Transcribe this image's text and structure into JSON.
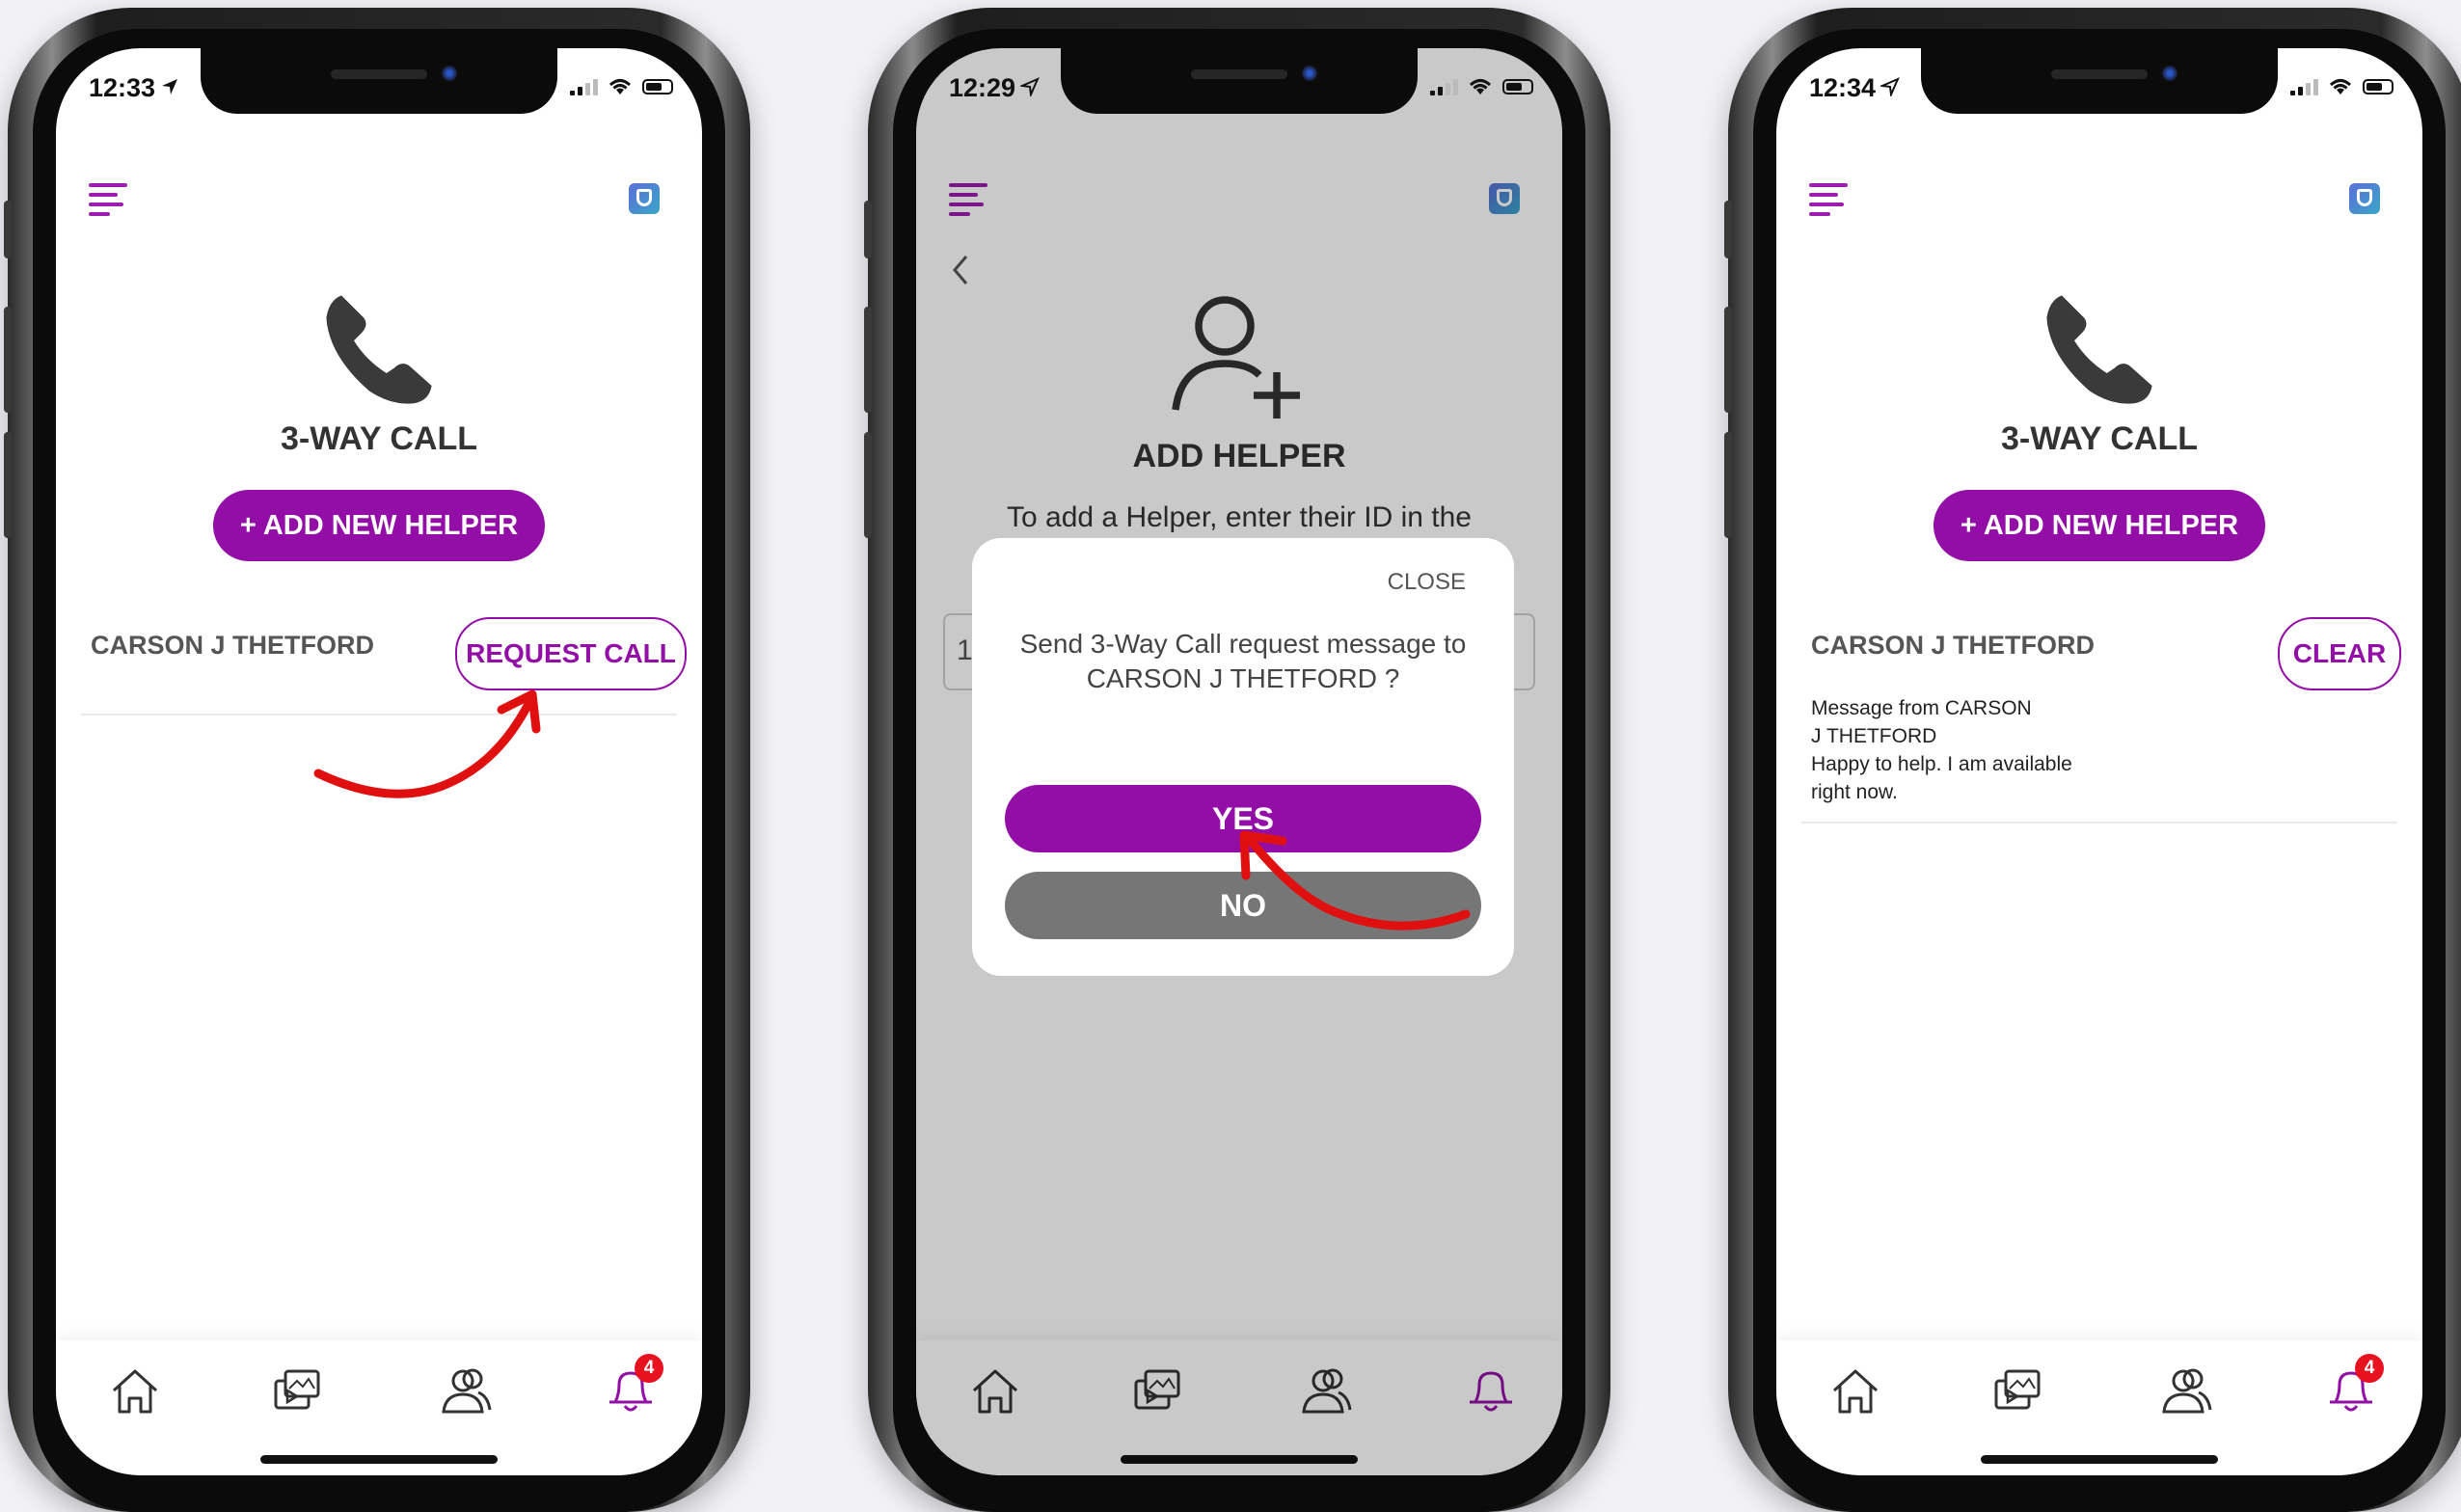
{
  "phones": [
    {
      "time": "12:33",
      "title": "3-WAY CALL",
      "add_button": "+ ADD NEW HELPER",
      "helper_name": "CARSON J THETFORD",
      "action_button": "REQUEST CALL",
      "notification_badge": "4"
    },
    {
      "time": "12:29",
      "title": "ADD HELPER",
      "instruction": "To add a Helper, enter their ID in the",
      "field_peek": "1",
      "dialog": {
        "close": "CLOSE",
        "message": "Send 3-Way Call request message to CARSON J THETFORD ?",
        "yes": "YES",
        "no": "NO"
      }
    },
    {
      "time": "12:34",
      "title": "3-WAY CALL",
      "add_button": "+ ADD NEW HELPER",
      "helper_name": "CARSON J THETFORD",
      "action_button": "CLEAR",
      "message_lines": [
        "Message from CARSON",
        "J THETFORD",
        "Happy to help. I am available",
        "right now."
      ],
      "notification_badge": "4"
    }
  ],
  "colors": {
    "accent": "#930ea6",
    "no_button": "#767676",
    "badge": "#e8111f",
    "annotation_arrow": "#e01010"
  },
  "tab_icons": [
    "home-icon",
    "media-icon",
    "people-icon",
    "bell-icon"
  ]
}
